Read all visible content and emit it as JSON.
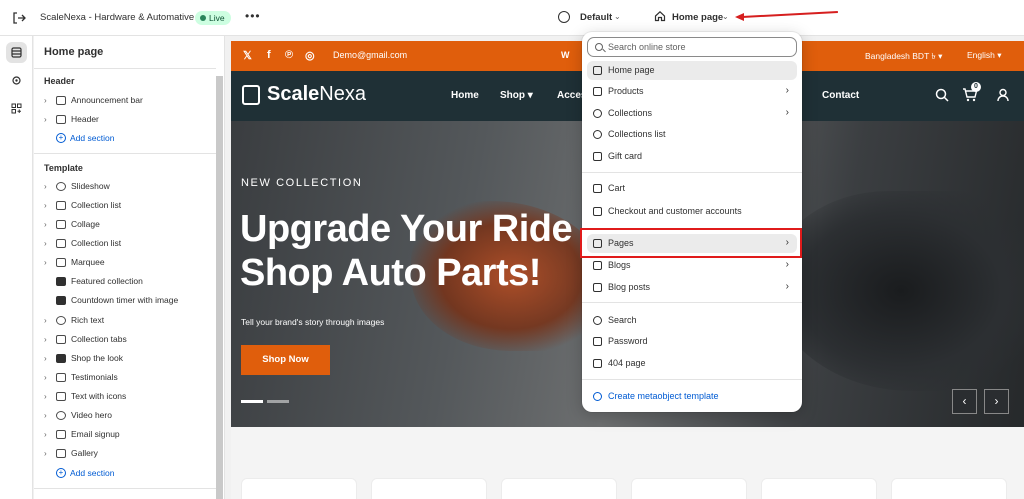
{
  "topbar": {
    "store_name": "ScaleNexa - Hardware & Automative",
    "live_badge": "Live",
    "more": "•••",
    "theme_name": "Default",
    "current_page": "Home page"
  },
  "sidebar": {
    "title": "Home page",
    "header_group": {
      "label": "Header",
      "items": [
        {
          "label": "Announcement bar"
        },
        {
          "label": "Header"
        }
      ],
      "add_label": "Add section"
    },
    "template_group": {
      "label": "Template",
      "items": [
        {
          "label": "Slideshow",
          "icon": "slideshow-icon"
        },
        {
          "label": "Collection list",
          "icon": "collection-list-icon"
        },
        {
          "label": "Collage",
          "icon": "collage-icon"
        },
        {
          "label": "Collection list",
          "icon": "collection-list-icon"
        },
        {
          "label": "Marquee",
          "icon": "marquee-icon"
        },
        {
          "label": "Featured collection",
          "icon": "featured-collection-icon"
        },
        {
          "label": "Countdown timer with image",
          "icon": "countdown-image-icon"
        },
        {
          "label": "Rich text",
          "icon": "rich-text-icon"
        },
        {
          "label": "Collection tabs",
          "icon": "collection-tabs-icon"
        },
        {
          "label": "Shop the look",
          "icon": "shop-the-look-icon"
        },
        {
          "label": "Testimonials",
          "icon": "testimonials-icon"
        },
        {
          "label": "Text with icons",
          "icon": "text-with-icons-icon"
        },
        {
          "label": "Video hero",
          "icon": "video-icon"
        },
        {
          "label": "Email signup",
          "icon": "email-icon"
        },
        {
          "label": "Gallery",
          "icon": "gallery-icon"
        }
      ],
      "add_label": "Add section"
    }
  },
  "preview": {
    "announcement": {
      "email": "Demo@gmail.com",
      "message": "W",
      "currency": "Bangladesh BDT ৳ ▾",
      "language": "English ▾",
      "social": [
        "𝕏",
        "f",
        "℗",
        "◎"
      ]
    },
    "header": {
      "logo_bold": "Scale",
      "logo_rest": "Nexa",
      "nav": [
        "Home",
        "Shop ▾",
        "Access",
        "Contact"
      ],
      "cart_count": "0"
    },
    "hero": {
      "kicker": "NEW COLLECTION",
      "headline_line1": "Upgrade Your Ride",
      "headline_line2": "Shop Auto Parts!",
      "subtitle": "Tell your brand's story through images",
      "button": "Shop Now",
      "prev": "‹",
      "next": "›"
    }
  },
  "dropdown": {
    "search_placeholder": "Search online store",
    "items": [
      {
        "label": "Home page",
        "selected": true,
        "has_submenu": false
      },
      {
        "label": "Products",
        "has_submenu": true
      },
      {
        "label": "Collections",
        "has_submenu": true
      },
      {
        "label": "Collections list",
        "has_submenu": false
      },
      {
        "label": "Gift card",
        "has_submenu": false
      },
      {
        "label": "Cart",
        "has_submenu": false
      },
      {
        "label": "Checkout and customer accounts",
        "has_submenu": false
      },
      {
        "label": "Pages",
        "has_submenu": true,
        "highlighted": true
      },
      {
        "label": "Blogs",
        "has_submenu": true
      },
      {
        "label": "Blog posts",
        "has_submenu": true
      },
      {
        "label": "Search",
        "has_submenu": false
      },
      {
        "label": "Password",
        "has_submenu": false
      },
      {
        "label": "404 page",
        "has_submenu": false
      }
    ],
    "create_label": "Create metaobject template",
    "chevron": "›"
  },
  "colors": {
    "brand_orange": "#e05e0c",
    "header_dark": "#1f3036",
    "link_blue": "#005bd3",
    "annotation_red": "#e01b1b",
    "live_green": "#cdfee1"
  }
}
